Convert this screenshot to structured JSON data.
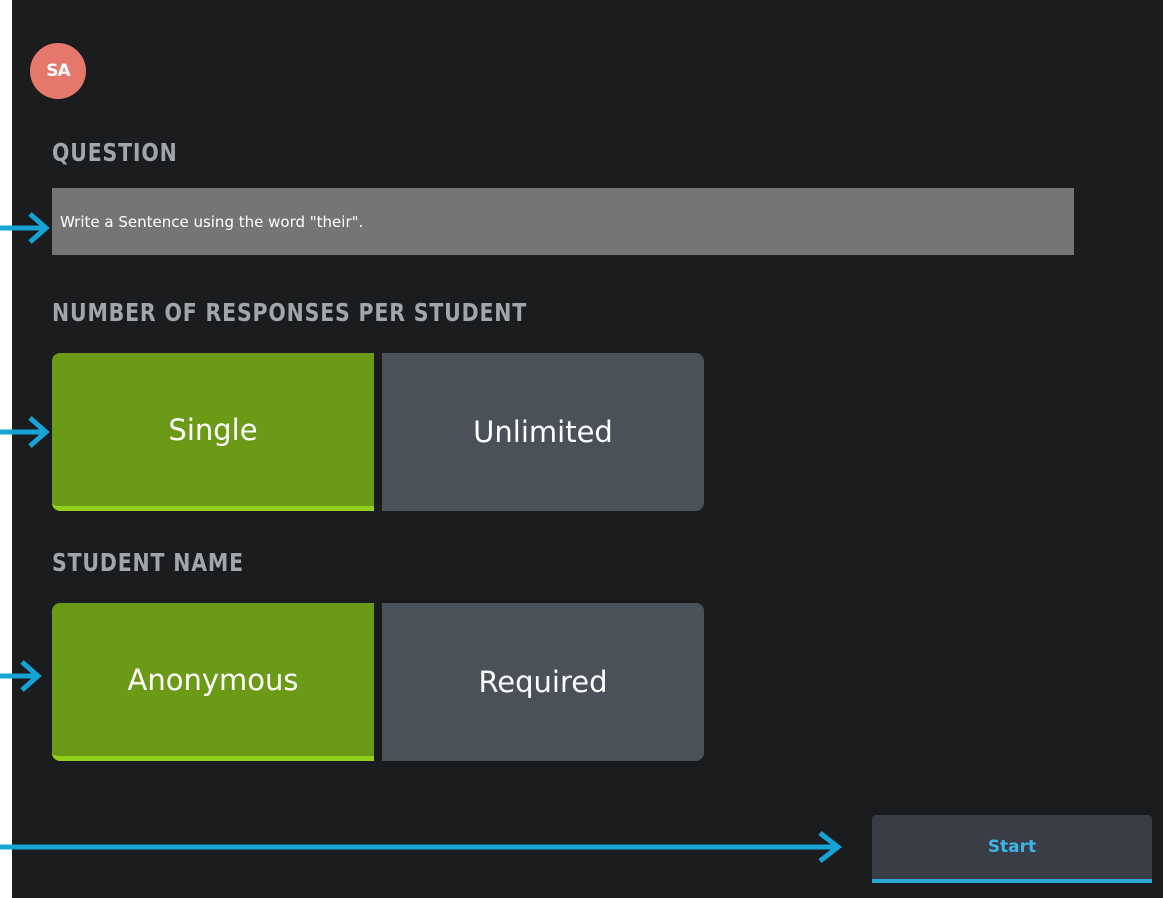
{
  "app": {
    "logo_text": "SA"
  },
  "question": {
    "label": "QUESTION",
    "value": "Write a Sentence using the word \"their\"."
  },
  "responses": {
    "label": "NUMBER OF RESPONSES PER STUDENT",
    "options": [
      "Single",
      "Unlimited"
    ],
    "selected": "Single"
  },
  "student_name": {
    "label": "STUDENT NAME",
    "options": [
      "Anonymous",
      "Required"
    ],
    "selected": "Anonymous"
  },
  "start_button": {
    "label": "Start"
  },
  "colors": {
    "background": "#1b1c1e",
    "selected": "#6b9a16",
    "unselected": "#4b5159",
    "accent": "#2ba4d8",
    "logo": "#e5776b"
  }
}
